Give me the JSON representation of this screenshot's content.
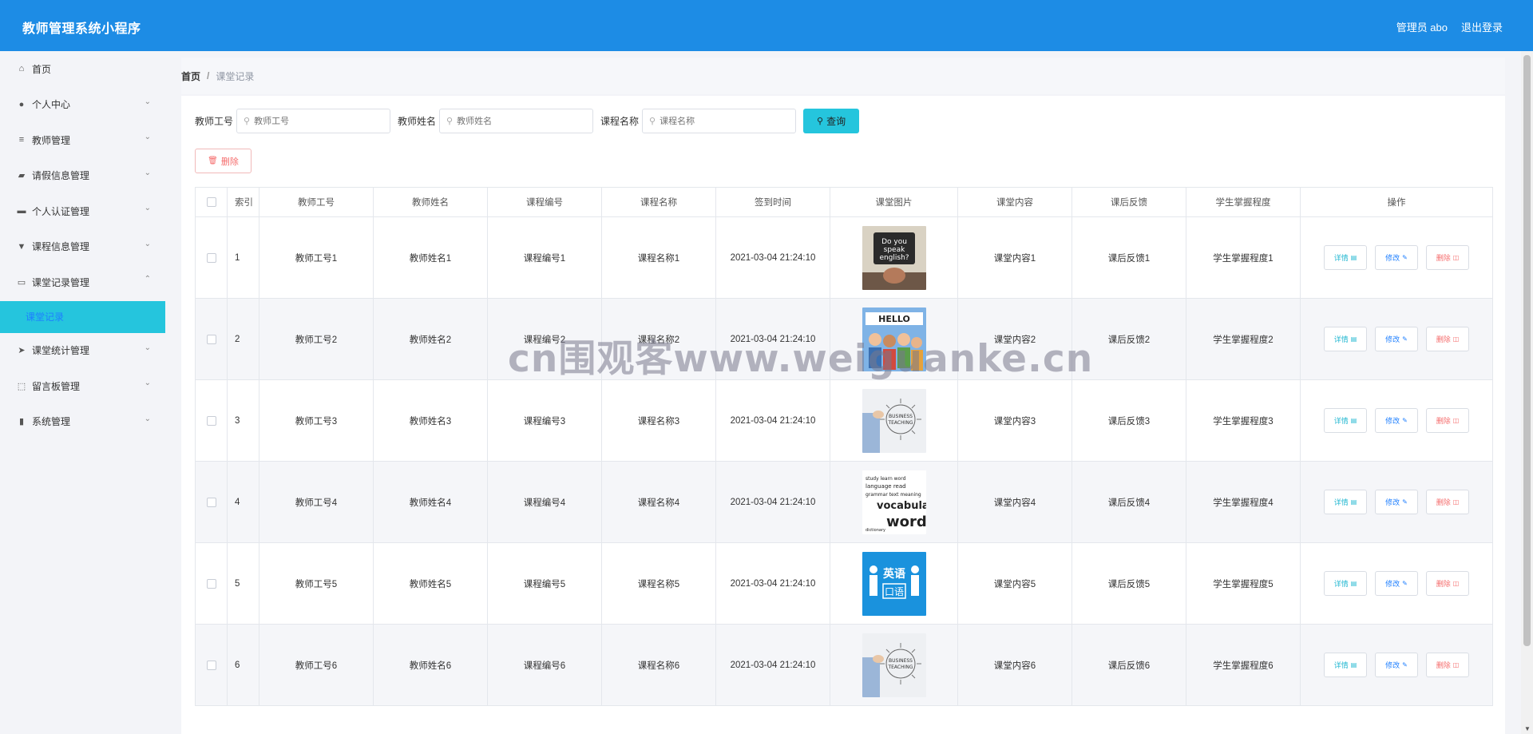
{
  "header": {
    "title": "教师管理系统小程序",
    "admin_label": "管理员 abo",
    "logout_label": "退出登录"
  },
  "sidebar": {
    "items": [
      {
        "label": "首页",
        "icon": "⌂",
        "has_children": false
      },
      {
        "label": "个人中心",
        "icon": "●",
        "has_children": true
      },
      {
        "label": "教师管理",
        "icon": "≡",
        "has_children": true
      },
      {
        "label": "请假信息管理",
        "icon": "▰",
        "has_children": true
      },
      {
        "label": "个人认证管理",
        "icon": "▬",
        "has_children": true
      },
      {
        "label": "课程信息管理",
        "icon": "▼",
        "has_children": true
      },
      {
        "label": "课堂记录管理",
        "icon": "▭",
        "has_children": true,
        "expanded": true
      }
    ],
    "active_sub_label": "课堂记录",
    "items_after": [
      {
        "label": "课堂统计管理",
        "icon": "➤",
        "has_children": true
      },
      {
        "label": "留言板管理",
        "icon": "⬚",
        "has_children": true
      },
      {
        "label": "系统管理",
        "icon": "▮",
        "has_children": true
      }
    ]
  },
  "breadcrumb": {
    "home": "首页",
    "sep": "/",
    "current": "课堂记录"
  },
  "search": {
    "teacher_id_label": "教师工号",
    "teacher_id_placeholder": "教师工号",
    "teacher_name_label": "教师姓名",
    "teacher_name_placeholder": "教师姓名",
    "course_name_label": "课程名称",
    "course_name_placeholder": "课程名称",
    "button_label": "查询"
  },
  "actions": {
    "delete_label": "删除"
  },
  "table": {
    "headers": [
      "索引",
      "教师工号",
      "教师姓名",
      "课程编号",
      "课程名称",
      "签到时间",
      "课堂图片",
      "课堂内容",
      "课后反馈",
      "学生掌握程度",
      "操作"
    ],
    "op_labels": {
      "detail": "详情",
      "edit": "修改",
      "delete": "删除"
    },
    "rows": [
      {
        "index": "1",
        "teacher_id": "教师工号1",
        "teacher_name": "教师姓名1",
        "course_id": "课程编号1",
        "course_name": "课程名称1",
        "checkin_time": "2021-03-04 21:24:10",
        "image": "do-you-speak-english",
        "content": "课堂内容1",
        "feedback": "课后反馈1",
        "mastery": "学生掌握程度1"
      },
      {
        "index": "2",
        "teacher_id": "教师工号2",
        "teacher_name": "教师姓名2",
        "course_id": "课程编号2",
        "course_name": "课程名称2",
        "checkin_time": "2021-03-04 21:24:10",
        "image": "hello-people",
        "content": "课堂内容2",
        "feedback": "课后反馈2",
        "mastery": "学生掌握程度2"
      },
      {
        "index": "3",
        "teacher_id": "教师工号3",
        "teacher_name": "教师姓名3",
        "course_id": "课程编号3",
        "course_name": "课程名称3",
        "checkin_time": "2021-03-04 21:24:10",
        "image": "teaching-sketch",
        "content": "课堂内容3",
        "feedback": "课后反馈3",
        "mastery": "学生掌握程度3"
      },
      {
        "index": "4",
        "teacher_id": "教师工号4",
        "teacher_name": "教师姓名4",
        "course_id": "课程编号4",
        "course_name": "课程名称4",
        "checkin_time": "2021-03-04 21:24:10",
        "image": "vocabulary-words",
        "content": "课堂内容4",
        "feedback": "课后反馈4",
        "mastery": "学生掌握程度4"
      },
      {
        "index": "5",
        "teacher_id": "教师工号5",
        "teacher_name": "教师姓名5",
        "course_id": "课程编号5",
        "course_name": "课程名称5",
        "checkin_time": "2021-03-04 21:24:10",
        "image": "english-speaking-blue",
        "content": "课堂内容5",
        "feedback": "课后反馈5",
        "mastery": "学生掌握程度5"
      },
      {
        "index": "6",
        "teacher_id": "教师工号6",
        "teacher_name": "教师姓名6",
        "course_id": "课程编号6",
        "course_name": "课程名称6",
        "checkin_time": "2021-03-04 21:24:10",
        "image": "teaching-sketch",
        "content": "课堂内容6",
        "feedback": "课后反馈6",
        "mastery": "学生掌握程度6"
      }
    ]
  },
  "watermark": "cn围观客www.weiguanke.cn",
  "colors": {
    "header_bg": "#1d8ce5",
    "accent": "#25c5dd",
    "danger": "#f56c6c",
    "link": "#1e7fff"
  }
}
